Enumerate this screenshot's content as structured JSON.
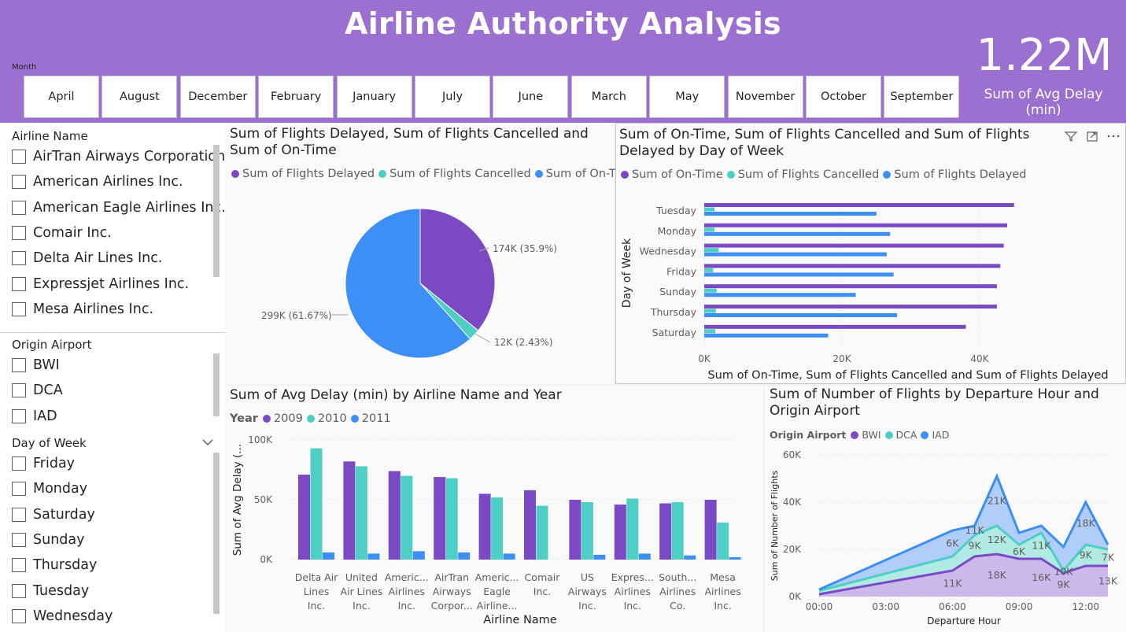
{
  "header": {
    "title": "Airline Authority Analysis",
    "month_label": "Month",
    "months": [
      "April",
      "August",
      "December",
      "February",
      "January",
      "July",
      "June",
      "March",
      "May",
      "November",
      "October",
      "September"
    ],
    "kpi_value": "1.22M",
    "kpi_label": "Sum of Avg Delay (min)"
  },
  "slicers": {
    "airline": {
      "title": "Airline Name",
      "items": [
        "AirTran Airways Corporation",
        "American Airlines Inc.",
        "American Eagle Airlines Inc.",
        "Comair Inc.",
        "Delta Air Lines Inc.",
        "Expressjet Airlines Inc.",
        "Mesa Airlines Inc."
      ]
    },
    "origin": {
      "title": "Origin Airport",
      "items": [
        "BWI",
        "DCA",
        "IAD"
      ]
    },
    "day": {
      "title": "Day of Week",
      "items": [
        "Friday",
        "Monday",
        "Saturday",
        "Sunday",
        "Thursday",
        "Tuesday",
        "Wednesday"
      ]
    }
  },
  "colors": {
    "purple": "#7b49c4",
    "teal": "#4fcec5",
    "blue": "#3d8ef5",
    "header": "#9b70d1"
  },
  "icons": [
    "filter-icon",
    "focus-mode-icon",
    "more-options-icon",
    "chevron-down-icon"
  ],
  "chart_data": [
    {
      "id": "pie",
      "type": "pie",
      "title": "Sum of Flights Delayed, Sum of Flights Cancelled and Sum of On-Time",
      "series": [
        {
          "name": "Sum of Flights Delayed",
          "value": 174000,
          "label": "174K (35.9%)"
        },
        {
          "name": "Sum of Flights Cancelled",
          "value": 12000,
          "label": "12K (2.43%)"
        },
        {
          "name": "Sum of On-Time",
          "value": 299000,
          "label": "299K (61.67%)"
        }
      ]
    },
    {
      "id": "bar",
      "type": "bar",
      "orientation": "horizontal",
      "title": "Sum of On-Time, Sum of Flights Cancelled and Sum of Flights Delayed by Day of Week",
      "categories": [
        "Tuesday",
        "Monday",
        "Wednesday",
        "Friday",
        "Sunday",
        "Thursday",
        "Saturday"
      ],
      "series": [
        {
          "name": "Sum of On-Time",
          "values": [
            45000,
            44000,
            43500,
            43000,
            42500,
            42500,
            38000
          ]
        },
        {
          "name": "Sum of Flights Cancelled",
          "values": [
            1500,
            1500,
            2100,
            1300,
            1800,
            1700,
            1600
          ]
        },
        {
          "name": "Sum of Flights Delayed",
          "values": [
            25000,
            27000,
            26500,
            27500,
            22000,
            28000,
            18000
          ]
        }
      ],
      "xlabel": "Sum of On-Time, Sum of Flights Cancelled and Sum of Flights Delayed",
      "ylabel": "Day of Week",
      "xticks": [
        "0K",
        "20K",
        "40K"
      ],
      "xlim": [
        0,
        48000
      ]
    },
    {
      "id": "column",
      "type": "bar",
      "title": "Sum of Avg Delay (min) by Airline Name and Year",
      "legend_title": "Year",
      "categories": [
        [
          "Delta Air",
          "Lines",
          "Inc."
        ],
        [
          "United",
          "Air Lines",
          "Inc."
        ],
        [
          "Americ...",
          "Airlines",
          "Inc."
        ],
        [
          "AirTran",
          "Airways",
          "Corpor..."
        ],
        [
          "Americ...",
          "Eagle",
          "Airline..."
        ],
        [
          "Comair",
          "Inc."
        ],
        [
          "US",
          "Airways",
          "Inc."
        ],
        [
          "Expres...",
          "Airlines",
          "Inc."
        ],
        [
          "South...",
          "Airlines",
          "Co."
        ],
        [
          "Mesa",
          "Airlines",
          "Inc."
        ]
      ],
      "series": [
        {
          "name": "2009",
          "values": [
            71000,
            82000,
            74000,
            69000,
            55000,
            58000,
            50000,
            46000,
            47000,
            50000
          ]
        },
        {
          "name": "2010",
          "values": [
            93000,
            78000,
            70000,
            68000,
            52000,
            45000,
            48000,
            51000,
            48000,
            31000
          ]
        },
        {
          "name": "2011",
          "values": [
            6000,
            5000,
            7000,
            6000,
            5000,
            0,
            4000,
            5000,
            3500,
            2000
          ]
        }
      ],
      "xlabel": "Airline Name",
      "ylabel": "Sum of Avg Delay (...",
      "yticks": [
        "0K",
        "50K",
        "100K"
      ],
      "ylim": [
        0,
        100000
      ]
    },
    {
      "id": "area",
      "type": "area",
      "title": "Sum of Number of Flights by Departure Hour and Origin Airport",
      "legend_title": "Origin Airport",
      "x": [
        0,
        6,
        7,
        8,
        9,
        10,
        11,
        12,
        13
      ],
      "x_hours_note": "Departure hours 00:00 through 13:00",
      "series": [
        {
          "name": "BWI",
          "values": [
            1000,
            11000,
            17000,
            18000,
            16000,
            16000,
            10000,
            13000,
            13000
          ],
          "labels": [
            "",
            "11K",
            "",
            "18K",
            "",
            "16K",
            "9K",
            "",
            "13K"
          ]
        },
        {
          "name": "DCA",
          "values": [
            1500,
            6000,
            9000,
            12000,
            6000,
            11000,
            1000,
            9000,
            7000
          ],
          "labels": [
            "",
            "",
            "9K",
            "12K",
            "6K",
            "11K",
            "10K",
            "9K",
            "7K"
          ]
        },
        {
          "name": "IAD",
          "values": [
            500,
            11000,
            4000,
            21000,
            5000,
            3000,
            10000,
            18000,
            2000
          ],
          "labels": [
            "",
            "6K",
            "11K",
            "21K",
            "",
            "",
            "",
            "18K",
            ""
          ]
        }
      ],
      "xlabel": "Departure Hour",
      "ylabel": "Sum of Number of Flights",
      "xticks": [
        "00:00",
        "03:00",
        "06:00",
        "09:00",
        "12:00"
      ],
      "yticks": [
        "0K",
        "20K",
        "40K",
        "60K"
      ],
      "ylim": [
        0,
        60000
      ]
    }
  ]
}
